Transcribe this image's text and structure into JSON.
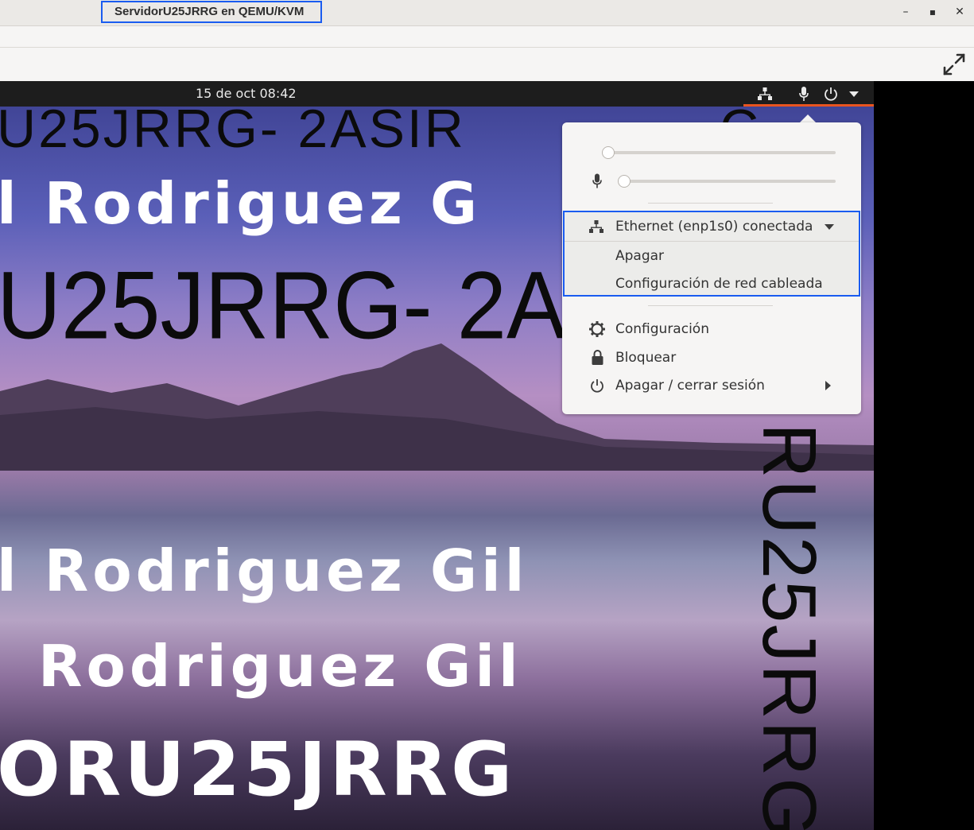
{
  "window": {
    "title": "ServidorU25JRRG en QEMU/KVM",
    "minimize_glyph": "–",
    "maximize_glyph": "▪",
    "close_glyph": "✕"
  },
  "topbar": {
    "clock": "15 de oct  08:42",
    "accent_color": "#e95420"
  },
  "wallpaper": {
    "line1": "U25JRRG- 2ASIR",
    "line1b": "C",
    "line2": "l Rodriguez G",
    "line3": "U25JRRG- 2AS",
    "line4": "l Rodriguez Gil",
    "line5": "Rodriguez Gil",
    "line6": "ORU25JRRG",
    "vertical": "RU25JRRG"
  },
  "system_menu": {
    "volume_level": 0.0,
    "mic_level": 0.0,
    "ethernet": {
      "label": "Ethernet (enp1s0) conectada",
      "items": [
        "Apagar",
        "Configuración de red cableada"
      ]
    },
    "settings_label": "Configuración",
    "lock_label": "Bloquear",
    "power_label": "Apagar / cerrar sesión"
  },
  "icons": {
    "fullscreen": "fullscreen-icon",
    "network": "network-wired-icon",
    "mic": "microphone-icon",
    "power": "power-icon",
    "dropdown": "caret-down-icon",
    "settings": "gear-icon",
    "lock": "lock-icon"
  }
}
